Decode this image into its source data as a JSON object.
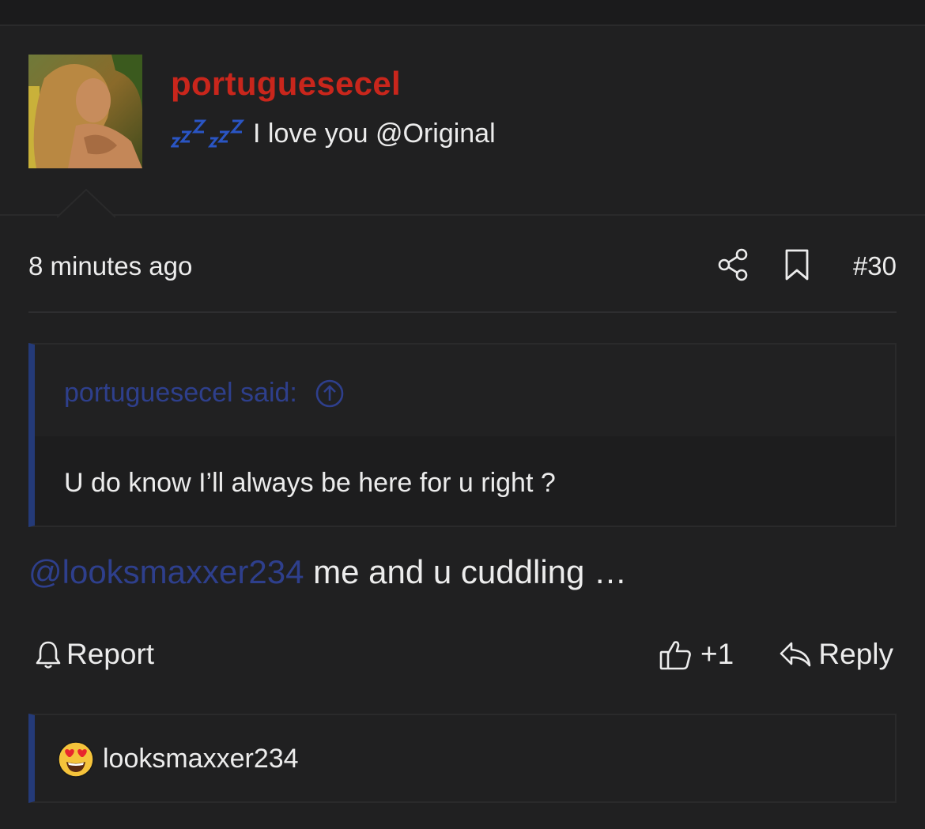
{
  "post": {
    "author": "portuguesecel",
    "status_icon": "zzz-sleeping-icon",
    "status_text": "I love you @Original",
    "time": "8 minutes ago",
    "number": "#30",
    "avatar_icon": "user-avatar-photo"
  },
  "quote": {
    "author_label": "portuguesecel said:",
    "text": "U do know I’ll always be here for u right ?"
  },
  "message": {
    "mention": "@looksmaxxer234",
    "text": " me and u cuddling …"
  },
  "actions": {
    "report_label": "Report",
    "like_count": "+1",
    "reply_label": "Reply"
  },
  "reactions": {
    "emoji": "heart-eyes-emoji",
    "user": "looksmaxxer234"
  },
  "colors": {
    "background": "#202021",
    "username": "#c9261c",
    "mention": "#2e3f8c",
    "quote_bar": "#243a78",
    "zzz": "#2a55c4"
  }
}
